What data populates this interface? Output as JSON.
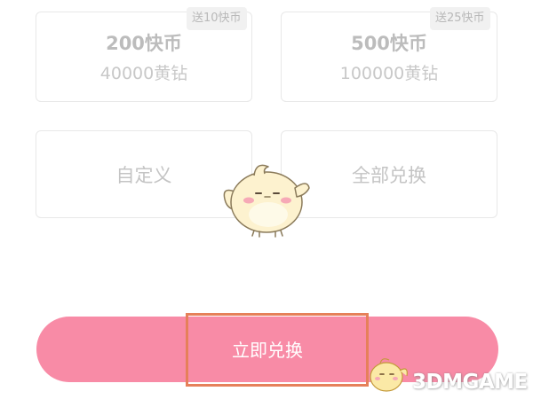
{
  "packages": [
    {
      "amount": "200快币",
      "diamonds": "40000黄钻",
      "bonus": "送10快币"
    },
    {
      "amount": "500快币",
      "diamonds": "100000黄钻",
      "bonus": "送25快币"
    }
  ],
  "options": {
    "custom_label": "自定义",
    "all_label": "全部兑换"
  },
  "exchange_button": {
    "label": "立即兑换"
  },
  "watermark": {
    "text": "3DMGAME"
  },
  "colors": {
    "accent_pink": "#f88ba6",
    "highlight_outline": "#e6805a",
    "card_border": "#e8e8e8"
  }
}
